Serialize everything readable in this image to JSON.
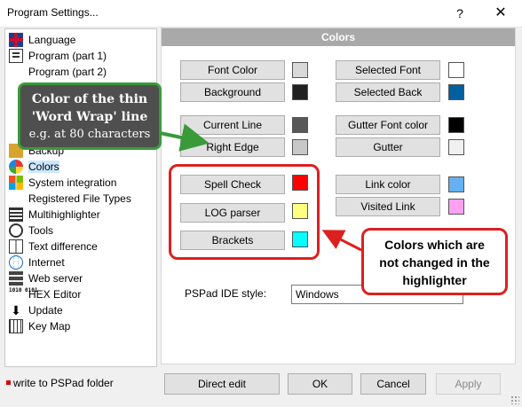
{
  "window": {
    "title": "Program Settings...",
    "help_glyph": "?",
    "close_glyph": "✕"
  },
  "sidebar": {
    "items": [
      {
        "label": "Language",
        "icon": "uk-flag-icon"
      },
      {
        "label": "Program  (part 1)",
        "icon": "program-icon"
      },
      {
        "label": "Program  (part 2)",
        "icon": ""
      },
      {
        "label": "Backup",
        "icon": "backup-icon"
      },
      {
        "label": "Colors",
        "icon": "palette-icon",
        "selected": true
      },
      {
        "label": "System integration",
        "icon": "windows-icon"
      },
      {
        "label": "Registered File Types",
        "icon": ""
      },
      {
        "label": "Multihighlighter",
        "icon": "multihighlighter-icon"
      },
      {
        "label": "Tools",
        "icon": "gear-icon"
      },
      {
        "label": "Text difference",
        "icon": "diff-icon"
      },
      {
        "label": "Internet",
        "icon": "globe-icon"
      },
      {
        "label": "Web server",
        "icon": "server-icon"
      },
      {
        "label": "HEX Editor",
        "icon": "hex-icon"
      },
      {
        "label": "Update",
        "icon": "update-icon"
      },
      {
        "label": "Key Map",
        "icon": "keymap-icon"
      }
    ],
    "status_text": "write to PSPad folder",
    "hex_icon_text": "1010 0101"
  },
  "colors_panel": {
    "header": "Colors",
    "left": [
      {
        "label": "Font Color",
        "color": "#d9d9d9"
      },
      {
        "label": "Background",
        "color": "#202020"
      },
      {
        "label": "Current Line",
        "color": "#585858"
      },
      {
        "label": "Right Edge",
        "color": "#c8c8c8"
      },
      {
        "label": "Spell Check",
        "color": "#ff0000"
      },
      {
        "label": "LOG parser",
        "color": "#ffff80"
      },
      {
        "label": "Brackets",
        "color": "#00ffff"
      }
    ],
    "right": [
      {
        "label": "Selected Font",
        "color": "#ffffff"
      },
      {
        "label": "Selected Back",
        "color": "#00609f"
      },
      {
        "label": "Gutter Font color",
        "color": "#000000"
      },
      {
        "label": "Gutter",
        "color": "#f0f0f0"
      },
      {
        "label": "Link color",
        "color": "#64b0f0"
      },
      {
        "label": "Visited Link",
        "color": "#ffa0f0"
      }
    ],
    "ide_style_label": "PSPad IDE style:",
    "ide_style_value": "Windows"
  },
  "annotations": {
    "word_wrap": {
      "line1": "Color of the thin",
      "line2": "'Word Wrap' line",
      "line3": "e.g. at 80 characters"
    },
    "not_changed": {
      "line1": "Colors which are",
      "line2": "not changed in the",
      "line3": "highlighter"
    }
  },
  "footer": {
    "direct_edit": "Direct edit",
    "ok": "OK",
    "cancel": "Cancel",
    "apply": "Apply"
  }
}
